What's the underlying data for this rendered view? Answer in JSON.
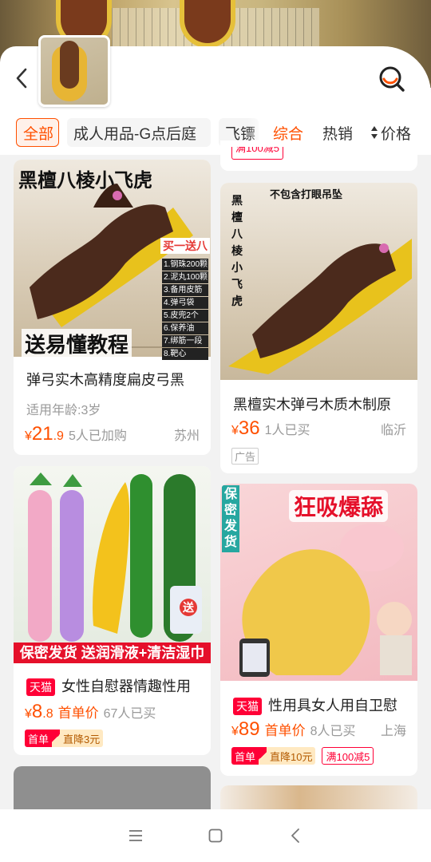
{
  "header": {
    "back_icon": "back-chevron-icon",
    "search_icon": "search-lens-icon"
  },
  "filters": {
    "chips": [
      "全部",
      "成人用品-G点后庭",
      "飞镖"
    ],
    "sort": [
      "综合",
      "热销",
      "价格"
    ],
    "active_color": "#ff5000"
  },
  "partial_top": {
    "right_text": "满100减5"
  },
  "products": [
    {
      "overlay_title": "黑檀八棱小飞虎",
      "overlay_badge": "买一送八",
      "overlay_list": [
        "1.钢珠200颗",
        "2.泥丸100颗",
        "3.备用皮筋",
        "4.弹弓袋",
        "5.皮兜2个",
        "6.保养油",
        "7.绑筋一段",
        "8.靶心"
      ],
      "overlay_bottom": "送易懂教程",
      "title": "弹弓实木高精度扁皮弓黑",
      "age": "适用年龄:3岁",
      "price_symbol": "¥",
      "price_int": "21",
      "price_dec": ".9",
      "sold": "5人已加购",
      "location": "苏州"
    },
    {
      "overlay_top": "不包含打眼吊坠",
      "overlay_side": "黑檀八棱小飞虎",
      "title": "黑檀实木弹弓木质木制原",
      "price_symbol": "¥",
      "price_int": "36",
      "sold": "1人已买",
      "location": "临沂",
      "ad": "广告"
    },
    {
      "overlay_badge": "送",
      "overlay_bottom": "保密发货  送润滑液+清洁湿巾",
      "tmall": "天猫",
      "title": "女性自慰器情趣性用",
      "price_symbol": "¥",
      "price_int": "8",
      "price_dec": ".8",
      "first_price": "首单价",
      "sold": "67人已买",
      "coupon_a": "首单",
      "coupon_b": "直降3元"
    },
    {
      "overlay_side": "保密发货",
      "overlay_title": "狂吸爆舔",
      "tmall": "天猫",
      "title": "性用具女人用自卫慰",
      "price_symbol": "¥",
      "price_int": "89",
      "first_price": "首单价",
      "sold": "8人已买",
      "location": "上海",
      "coupon_a": "首单",
      "coupon_b": "直降10元",
      "coupon_full": "满100减5"
    }
  ],
  "navbar": {
    "icons": [
      "menu-icon",
      "home-square-icon",
      "back-triangle-icon"
    ]
  }
}
